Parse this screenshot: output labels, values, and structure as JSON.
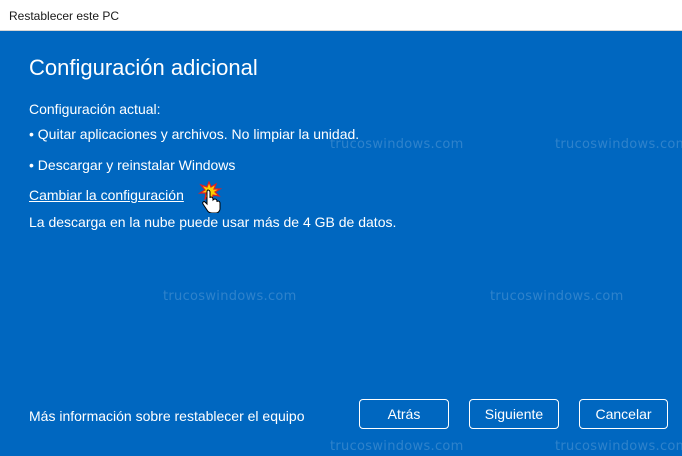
{
  "window": {
    "title": "Restablecer este PC"
  },
  "content": {
    "heading": "Configuración adicional",
    "current_label": "Configuración actual:",
    "bullets": [
      "• Quitar aplicaciones y archivos. No limpiar la unidad.",
      "• Descargar y reinstalar Windows"
    ],
    "change_link": "Cambiar la configuración",
    "cloud_note": "La descarga en la nube puede usar más de 4 GB de datos."
  },
  "footer": {
    "info_link": "Más información sobre restablecer el equipo",
    "back_label": "Atrás",
    "next_label": "Siguiente",
    "cancel_label": "Cancelar"
  },
  "watermark": {
    "text": "trucoswindows.com"
  },
  "colors": {
    "accent": "#0067c0",
    "titlebar": "#ffffff",
    "text": "#ffffff"
  }
}
